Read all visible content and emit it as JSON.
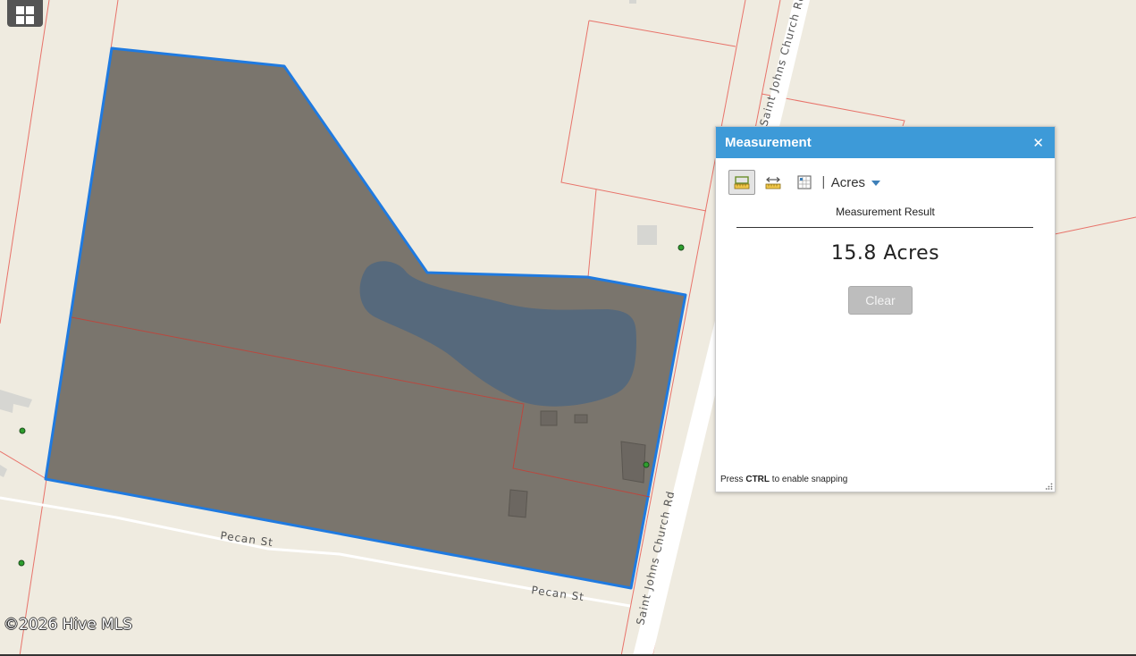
{
  "map": {
    "road_labels": {
      "pecan_st_1": "Pecan St",
      "pecan_st_2": "Pecan St",
      "saint_johns_upper": "Saint Johns Church Rd",
      "saint_johns_lower": "Saint Johns Church Rd"
    },
    "copyright": "©2026 Hive MLS",
    "colors": {
      "background": "#efebe0",
      "parcel_line": "#e8736a",
      "selection_outline": "#1f7ae0",
      "selection_fill": "#7a756d",
      "water": "#56697c"
    },
    "layers_button_icon": "grid-icon"
  },
  "panel": {
    "title": "Measurement",
    "close_icon": "close-icon",
    "tools": [
      {
        "name": "area-tool",
        "icon": "area-ruler-icon",
        "active": true
      },
      {
        "name": "distance-tool",
        "icon": "distance-ruler-icon",
        "active": false
      },
      {
        "name": "location-tool",
        "icon": "location-grid-icon",
        "active": false
      }
    ],
    "separator": "|",
    "unit": "Acres",
    "result_label": "Measurement Result",
    "result_value": "15.8 Acres",
    "clear_label": "Clear",
    "hint_prefix": "Press ",
    "hint_key": "CTRL",
    "hint_suffix": " to enable snapping"
  }
}
